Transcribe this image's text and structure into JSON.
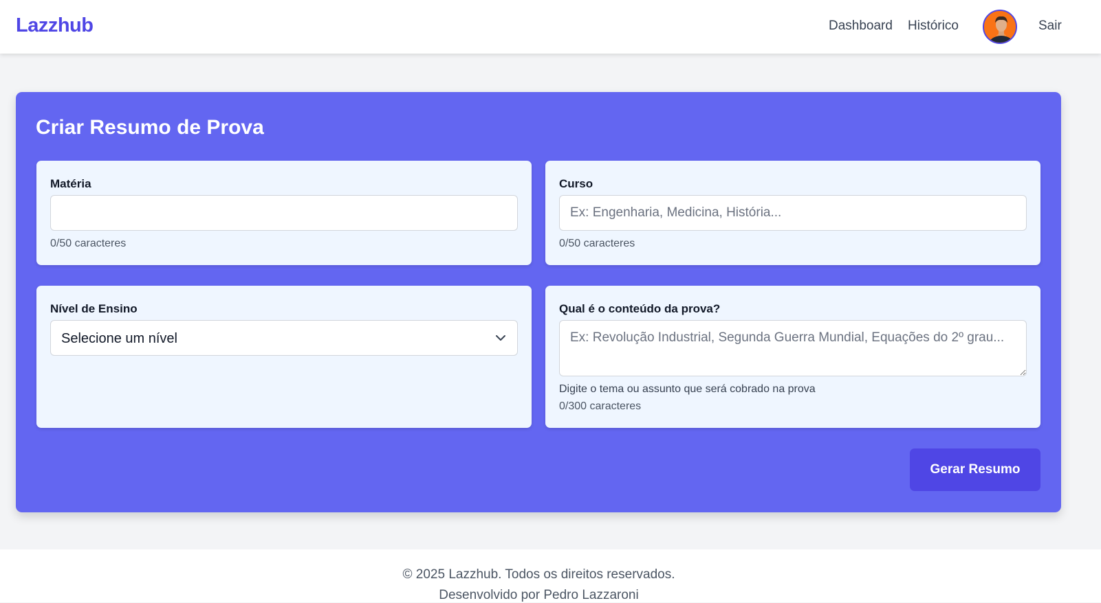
{
  "navbar": {
    "brand": "Lazzhub",
    "links": {
      "dashboard": "Dashboard",
      "historico": "Histórico",
      "logout": "Sair"
    },
    "avatar_icon": "user-avatar"
  },
  "form": {
    "title": "Criar Resumo de Prova",
    "materia": {
      "label": "Matéria",
      "value": "",
      "placeholder": "",
      "counter": "0/50 caracteres"
    },
    "curso": {
      "label": "Curso",
      "value": "",
      "placeholder": "Ex: Engenharia, Medicina, História...",
      "counter": "0/50 caracteres"
    },
    "nivel": {
      "label": "Nível de Ensino",
      "selected": "Selecione um nível",
      "icon": "chevron-down-icon"
    },
    "conteudo": {
      "label": "Qual é o conteúdo da prova?",
      "value": "",
      "placeholder": "Ex: Revolução Industrial, Segunda Guerra Mundial, Equações do 2º grau...",
      "helper": "Digite o tema ou assunto que será cobrado na prova",
      "counter": "0/300 caracteres"
    },
    "submit_label": "Gerar Resumo"
  },
  "footer": {
    "copyright": "© 2025 Lazzhub. Todos os direitos reservados.",
    "credit": "Desenvolvido por Pedro Lazzaroni"
  },
  "colors": {
    "brand": "#4f46e5",
    "card_background": "#6366f1",
    "panel_background": "#eff6ff",
    "page_background": "#f3f4f6"
  }
}
